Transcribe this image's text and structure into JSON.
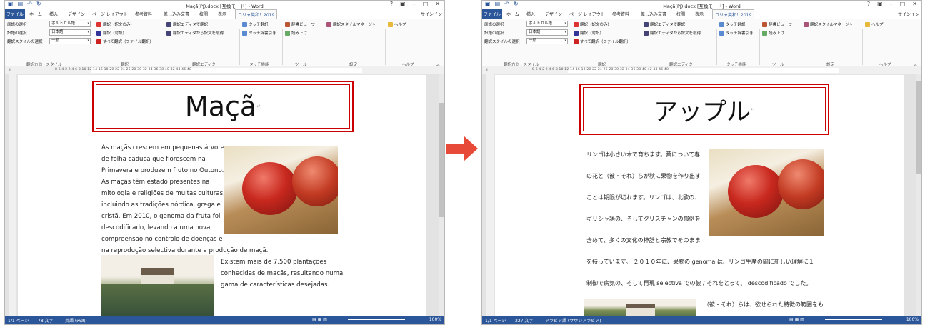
{
  "colors": {
    "word_blue": "#2b579a",
    "title_border": "#cc0000",
    "arrow": "#e84a3a"
  },
  "left": {
    "title": "Maçã(PJ).docx [互換モード] - Word",
    "doc_title": "Maçã",
    "body_lines": [
      "As maçãs crescem em pequenas árvores",
      "de folha caduca que florescem na",
      "Primavera e produzem fruto no Outono.",
      "As maçãs têm estado presentes na",
      "mitologia e religiões de muitas culturas,",
      "incluindo as tradições nórdica, grega e",
      "cristã. Em 2010, o genoma da fruta foi",
      "descodificado, levando a uma nova",
      "compreensão no controlo de doenças e",
      "na reprodução selectiva durante a produção de maçã."
    ],
    "body2_lines": [
      "Existem mais de 7.500 plantações",
      "conhecidas de maçãs, resultando numa",
      "gama de características desejadas."
    ],
    "status": {
      "page": "1/1 ページ",
      "words": "78 文字",
      "lang": "英語 (米国)",
      "zoom": "100%"
    },
    "source_lang": "ポルトガル語",
    "target_lang": "日本語",
    "style": "一般"
  },
  "right": {
    "title": "Maçã(PJ).docx [互換モード] - Word",
    "doc_title": "アップル",
    "body_lines": [
      "リンゴは小さい木で育ちます。葉について春",
      "の花と（彼・それ）らが秋に果物を作り出す",
      "ことは期限が切れます。リンゴは、北欧の、",
      "ギリシャ語の、そしてクリスチャンの慣例を",
      "含めて、多くの文化の神話と宗教でそのまま",
      "を持っています。 ２０１０年に、果物の genoma は、リンゴ生産の間に新しい理解に１",
      "制御で病気の、そして再現 selectiva での彼 / それをとって、 descodificado でした。"
    ],
    "body2_lines": [
      "（彼・それ）らは、欲せられた特徴の範囲をも"
    ],
    "status": {
      "page": "1/1 ページ",
      "words": "227 文字",
      "lang": "アラビア語 (サウジアラビア)",
      "zoom": "100%"
    },
    "source_lang": "ポルトガル語",
    "target_lang": "日本語",
    "style": "一般"
  },
  "tabs": [
    "ファイル",
    "ホーム",
    "挿入",
    "デザイン",
    "ページ レイアウト",
    "参考資料",
    "差し込み文書",
    "校閲",
    "表示",
    "コリャ英和！2019"
  ],
  "signin": "サインイン",
  "ribbon": {
    "src_label": "原語の選択",
    "tgt_label": "訳語の選択",
    "style_label": "翻訳スタイルの選択",
    "translate_only": "翻訳（訳文のみ）",
    "translate_parallel": "翻訳（対訳）",
    "translate_all": "すべて翻訳（ファイル翻訳）",
    "editor_translate": "翻訳エディタで翻訳",
    "editor_get": "翻訳エディタから訳文を取得",
    "touch_translate": "タッチ翻訳",
    "touch_dict": "タッチ辞書引き",
    "dict_viewer": "辞書ビューワ",
    "read_aloud": "読み上げ",
    "style_manager": "翻訳スタイルマネージャ",
    "help": "ヘルプ",
    "groups": [
      "翻訳方向・スタイル",
      "翻訳",
      "翻訳エディタ",
      "タッチ機能",
      "ツール",
      "設定",
      "ヘルプ"
    ]
  },
  "ruler_text": "8  6  4  2      2  4  6  8  10  12  14  16  18  20  22  24  26  28  30  32  34  36  38  40  42  44  46  48"
}
